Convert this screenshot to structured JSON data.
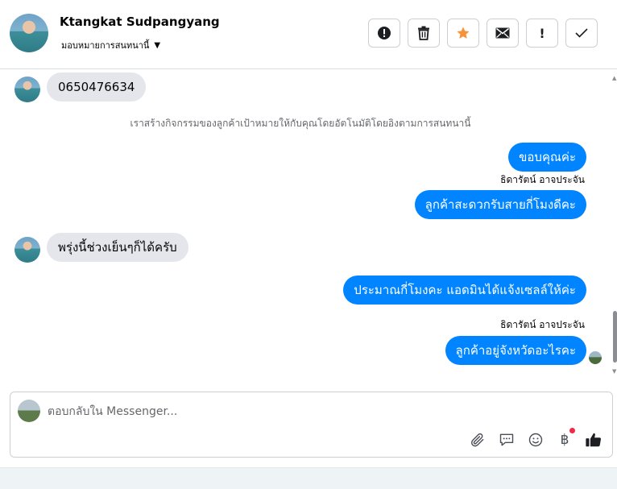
{
  "header": {
    "contact_name": "Ktangkat Sudpangyang",
    "assign_label": "มอบหมายการสนทนานี้",
    "actions": [
      {
        "name": "report-button",
        "icon": "alert-circle-icon"
      },
      {
        "name": "delete-button",
        "icon": "trash-icon"
      },
      {
        "name": "star-button",
        "icon": "star-icon"
      },
      {
        "name": "mark-unread-button",
        "icon": "envelope-icon"
      },
      {
        "name": "important-button",
        "icon": "exclamation-icon"
      },
      {
        "name": "mark-done-button",
        "icon": "check-icon"
      }
    ]
  },
  "messages": {
    "m1": "0650476634",
    "system_note": "เราสร้างกิจกรรมของลูกค้าเป้าหมายให้กับคุณโดยอัตโนมัติโดยอิงตามการสนทนานี้",
    "m2": "ขอบคุณค่ะ",
    "sender1": "ธิดารัตน์ อาจประจัน",
    "m3": "ลูกค้าสะดวกรับสายกี่โมงดีคะ",
    "m4": "พรุ่งนี้ช่วงเย็นๆก็ได้ครับ",
    "m5": "ประมาณกี่โมงคะ แอดมินได้แจ้งเซลล์ให้ค่ะ",
    "sender2": "ธิดารัตน์ อาจประจัน",
    "m6": "ลูกค้าอยู่จังหวัดอะไรคะ"
  },
  "composer": {
    "placeholder": "ตอบกลับใน Messenger...",
    "tools": [
      "paperclip-icon",
      "saved-reply-icon",
      "emoji-icon",
      "baht-icon",
      "thumbs-up-icon"
    ],
    "baht_symbol": "฿"
  },
  "colors": {
    "outgoing_bubble": "#0084ff",
    "incoming_bubble": "#e4e6eb",
    "star": "#f7923a",
    "notification_dot": "#f02849"
  }
}
